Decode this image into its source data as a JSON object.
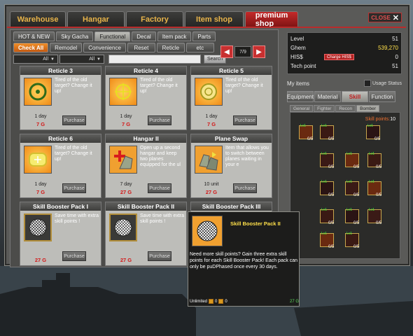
{
  "top_tabs": [
    {
      "label": "Warehouse"
    },
    {
      "label": "Hangar"
    },
    {
      "label": "Factory"
    },
    {
      "label": "Item shop"
    },
    {
      "label": "premium shop",
      "active": true
    }
  ],
  "close_label": "CLOSE",
  "sub_tabs": [
    {
      "label": "HOT & NEW"
    },
    {
      "label": "Sky Gacha"
    },
    {
      "label": "Functional",
      "active": true
    },
    {
      "label": "Decal"
    },
    {
      "label": "Item pack"
    },
    {
      "label": "Parts"
    }
  ],
  "filters": [
    {
      "label": "Check All",
      "active": true
    },
    {
      "label": "Remodel"
    },
    {
      "label": "Convenience"
    },
    {
      "label": "Reset"
    },
    {
      "label": "Reticle"
    },
    {
      "label": "etc"
    }
  ],
  "selects": [
    {
      "value": "All"
    },
    {
      "value": "All"
    }
  ],
  "search_label": "Search",
  "pager": {
    "page": "7/9"
  },
  "cards": [
    {
      "title": "Reticle 3",
      "desc": "Tired of the old target? Change it up!",
      "duration": "1 day",
      "price": "7 G",
      "buy": "Purchase",
      "thumb": "orange",
      "icon": "reticle-icon"
    },
    {
      "title": "Reticle 4",
      "desc": "Tired of the old target? Change it up!",
      "duration": "1 day",
      "price": "7 G",
      "buy": "Purchase",
      "thumb": "orange",
      "icon": "reticle-icon"
    },
    {
      "title": "Reticle 5",
      "desc": "Tired of the old target? Change it up!",
      "duration": "1 day",
      "price": "7 G",
      "buy": "Purchase",
      "thumb": "orange",
      "icon": "reticle-icon"
    },
    {
      "title": "Reticle 6",
      "desc": "Tired of the old target? Change it up!",
      "duration": "1 day",
      "price": "7 G",
      "buy": "Purchase",
      "thumb": "orange",
      "icon": "reticle-icon"
    },
    {
      "title": "Hangar II",
      "desc": "Open up a second hangar and keep two planes equipped for the ul",
      "duration": "7 day",
      "price": "27 G",
      "buy": "Purchase",
      "thumb": "red",
      "icon": "hangar-icon"
    },
    {
      "title": "Plane Swap",
      "desc": "Item that allows you to switch between planes waiting in your e",
      "duration": "10 unit",
      "price": "27 G",
      "buy": "Purchase",
      "thumb": "red",
      "icon": "plane-swap-icon"
    },
    {
      "title": "Skill Booster Pack I",
      "desc": "Save time with extra skill points !",
      "duration": "",
      "price": "27 G",
      "buy": "Purchase",
      "thumb": "dark",
      "icon": "skill-booster-icon"
    },
    {
      "title": "Skill Booster Pack II",
      "desc": "Save time with extra skill points !",
      "duration": "",
      "price": "27 G",
      "buy": "Purchase",
      "thumb": "dark",
      "icon": "skill-booster-icon"
    },
    {
      "title": "Skill Booster Pack III",
      "desc": "",
      "duration": "",
      "price": "",
      "buy": "",
      "thumb": "dark",
      "icon": "skill-booster-icon"
    }
  ],
  "stats": {
    "level_label": "Level",
    "level": "51",
    "ghem_label": "Ghem",
    "ghem": "539,270",
    "his_label": "HIS$",
    "charge_label": "Charge HIS$",
    "his": "0",
    "tech_label": "Tech point",
    "tech": "51"
  },
  "items": {
    "header": "My items",
    "usage": "Usage Status",
    "tabs": [
      {
        "label": "Equipment"
      },
      {
        "label": "Material"
      },
      {
        "label": "Skill",
        "active": true
      },
      {
        "label": "Function"
      }
    ],
    "class_tabs": [
      {
        "label": "General"
      },
      {
        "label": "Fighter"
      },
      {
        "label": "Recon"
      },
      {
        "label": "Bomber",
        "active": true
      }
    ],
    "skill_points_label": "Skill points:",
    "skill_points": "10",
    "skills": [
      {
        "lvl": "Lv1",
        "count": "0/5"
      },
      {
        "lvl": "Lv1",
        "count": "0/5"
      },
      {
        "lvl": "Lv1",
        "count": "0/5"
      },
      {
        "lvl": "Lv1",
        "count": "0/5"
      },
      {
        "lvl": "Lv1",
        "count": "0/5"
      },
      {
        "lvl": "Lv1",
        "count": "0/5"
      },
      {
        "lvl": "Lv1",
        "count": "0/5"
      },
      {
        "lvl": "Lv1",
        "count": "0/5"
      },
      {
        "lvl": "Lv1",
        "count": "0/5"
      },
      {
        "lvl": "Lv1",
        "count": "0/5"
      },
      {
        "lvl": "Lv1",
        "count": "0/5"
      },
      {
        "lvl": "Lv1",
        "count": "0/5"
      },
      {
        "lvl": "Lv1",
        "count": "0/5"
      },
      {
        "lvl": "Lv1",
        "count": "0/5"
      },
      {
        "lvl": "Lv1",
        "count": "0/5"
      },
      {
        "lvl": "Lv1",
        "count": "0/5"
      }
    ]
  },
  "tooltip": {
    "title": "Skill Booster Pack II",
    "desc": "Need more skill points? Gain three extra skill points for each Skill Booster Pack! Each pack can only be puDPhased once every 30 days.",
    "limit": "Unlimited",
    "qty1": "0",
    "qty2": "0",
    "price": "27 G"
  }
}
